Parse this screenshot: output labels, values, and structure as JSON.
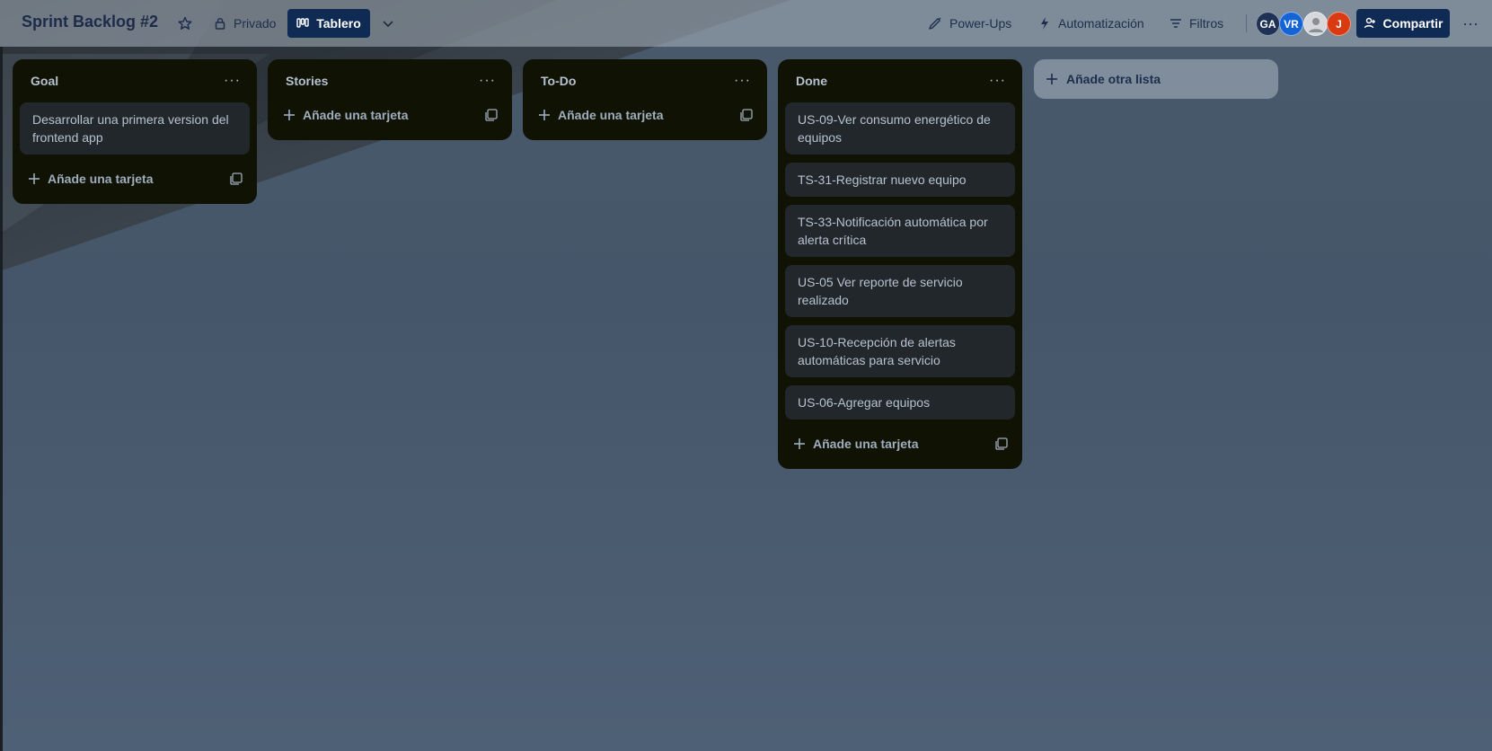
{
  "header": {
    "board_title": "Sprint Backlog #2",
    "visibility_label": "Privado",
    "view_label": "Tablero",
    "powerups_label": "Power-Ups",
    "automation_label": "Automatización",
    "filters_label": "Filtros",
    "share_label": "Compartir",
    "avatars": [
      "GA",
      "VR",
      "",
      "J"
    ]
  },
  "lists": [
    {
      "title": "Goal",
      "cards": [
        "Desarrollar una primera version del frontend app"
      ],
      "add_card_label": "Añade una tarjeta"
    },
    {
      "title": "Stories",
      "cards": [],
      "add_card_label": "Añade una tarjeta"
    },
    {
      "title": "To-Do",
      "cards": [],
      "add_card_label": "Añade una tarjeta"
    },
    {
      "title": "Done",
      "cards": [
        "US-09-Ver consumo energético de equipos",
        "TS-31-Registrar nuevo equipo",
        "TS-33-Notificación automática por alerta crítica",
        "US-05 Ver reporte de servicio realizado",
        "US-10-Recepción de alertas automáticas para servicio",
        "US-06-Agregar equipos"
      ],
      "add_card_label": "Añade una tarjeta"
    }
  ],
  "add_list_label": "Añade otra lista",
  "colors": {
    "list_bg": "#101204",
    "card_bg": "#22272b",
    "accent_button": "#0f2b53",
    "text": "#b6c2cf"
  }
}
